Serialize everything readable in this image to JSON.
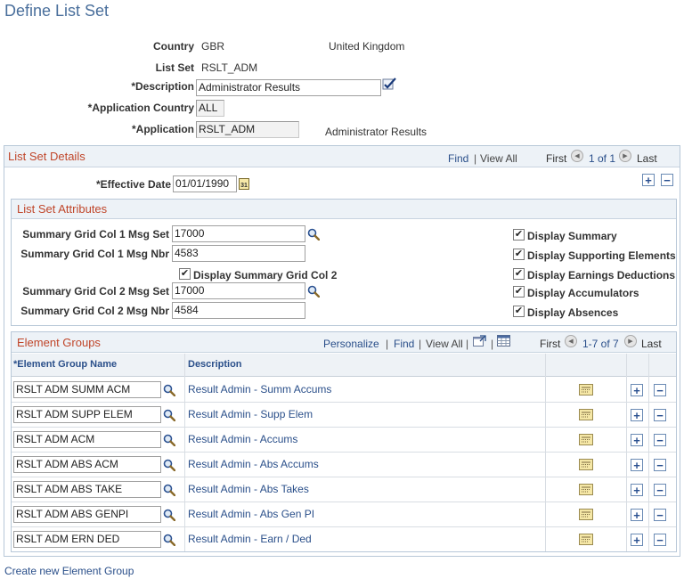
{
  "page": {
    "title": "Define List Set"
  },
  "header": {
    "country_label": "Country",
    "country_code": "GBR",
    "country_name": "United Kingdom",
    "listset_label": "List Set",
    "listset_value": "RSLT_ADM",
    "description_label": "*Description",
    "description_value": "Administrator Results",
    "app_country_label": "*Application Country",
    "app_country_value": "ALL",
    "application_label": "*Application",
    "application_value": "RSLT_ADM",
    "application_desc": "Administrator Results"
  },
  "details": {
    "title": "List Set Details",
    "find": "Find",
    "sep": "|",
    "view_all": "View All",
    "first": "First",
    "range": "1 of 1",
    "last": "Last",
    "effdt_label": "*Effective Date",
    "effdt_value": "01/01/1990",
    "calendar_glyph": "31"
  },
  "attributes": {
    "title": "List Set Attributes",
    "col1_set_label": "Summary Grid Col 1 Msg Set",
    "col1_set_value": "17000",
    "col1_nbr_label": "Summary Grid Col 1 Msg Nbr",
    "col1_nbr_value": "4583",
    "display_col2_label": "Display Summary Grid Col 2",
    "col2_set_label": "Summary Grid Col 2 Msg Set",
    "col2_set_value": "17000",
    "col2_nbr_label": "Summary Grid Col 2 Msg Nbr",
    "col2_nbr_value": "4584",
    "checks": [
      {
        "label": "Display Summary",
        "checked": true
      },
      {
        "label": "Display Supporting Elements",
        "checked": true
      },
      {
        "label": "Display Earnings Deductions",
        "checked": true
      },
      {
        "label": "Display Accumulators",
        "checked": true
      },
      {
        "label": "Display Absences",
        "checked": true
      }
    ],
    "check_mark": "✔"
  },
  "element_groups": {
    "title": "Element Groups",
    "personalize": "Personalize",
    "find": "Find",
    "view_all": "View All",
    "sep": "|",
    "first": "First",
    "range": "1-7 of 7",
    "last": "Last",
    "col_name": "*Element Group Name",
    "col_desc": "Description",
    "rows": [
      {
        "name": "RSLT ADM SUMM ACM",
        "desc": "Result Admin - Summ Accums"
      },
      {
        "name": "RSLT ADM SUPP ELEM",
        "desc": "Result Admin - Supp Elem"
      },
      {
        "name": "RSLT ADM ACM",
        "desc": "Result Admin - Accums"
      },
      {
        "name": "RSLT ADM ABS ACM",
        "desc": "Result Admin - Abs Accums"
      },
      {
        "name": "RSLT ADM ABS TAKE",
        "desc": "Result Admin - Abs Takes"
      },
      {
        "name": "RSLT ADM ABS GENPI",
        "desc": "Result Admin - Abs Gen PI"
      },
      {
        "name": "RSLT ADM ERN DED",
        "desc": "Result Admin - Earn / Ded"
      }
    ]
  },
  "footer": {
    "create_link": "Create new Element Group"
  },
  "symbols": {
    "plus": "+",
    "minus": "−",
    "prev": "◀",
    "next": "▶"
  },
  "colors": {
    "title": "#4a6f9c",
    "section_title": "#c0462a",
    "link": "#2a4f8a",
    "border": "#b8c8d8"
  }
}
